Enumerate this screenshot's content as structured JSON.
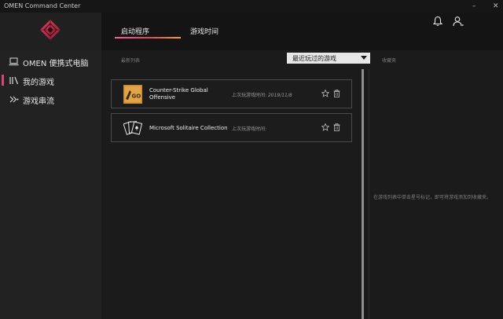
{
  "window": {
    "title": "OMEN Command Center",
    "controls": {
      "minimize": "–",
      "close": "✕"
    }
  },
  "sidebar": {
    "logo_icon": "omen-logo-icon",
    "items": [
      {
        "label": "OMEN 便携式电脑",
        "icon": "laptop-icon",
        "active": false
      },
      {
        "label": "我的游戏",
        "icon": "game-library-icon",
        "active": true
      },
      {
        "label": "游戏串流",
        "icon": "streaming-icon",
        "active": false
      }
    ]
  },
  "header": {
    "tabs": [
      {
        "label": "启动程序",
        "active": true
      },
      {
        "label": "游戏时间",
        "active": false
      }
    ],
    "icons": [
      "bell-icon",
      "user-account-icon"
    ]
  },
  "main": {
    "list_label": "最新列表",
    "sort": {
      "selected": "最近玩过的游戏"
    },
    "favorites_label": "收藏夹",
    "favorites_empty": "在游戏列表中单击星号标记，即可将游戏添加到收藏夹。",
    "games": [
      {
        "name": "Counter-Strike Global Offensive",
        "played_label": "上次玩游戏时间:",
        "played_date": "2019/11/8",
        "icon": "csgo-game-icon"
      },
      {
        "name": "Microsoft Solitaire Collection",
        "played_label": "上次玩游戏时间:",
        "played_date": "",
        "icon": "solitaire-cards-icon"
      }
    ]
  },
  "colors": {
    "accent_pink": "#d8467a",
    "tab_gradient_start": "#ff5aa0",
    "tab_gradient_end": "#ff9a3c",
    "sidebar_bg": "#222222",
    "content_bg": "#1b1b1b"
  }
}
